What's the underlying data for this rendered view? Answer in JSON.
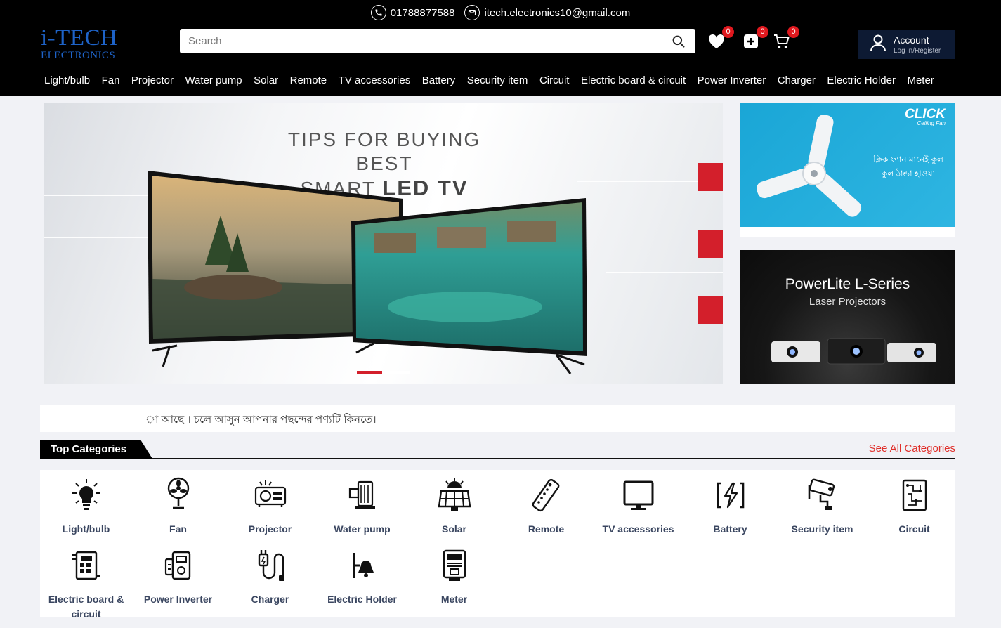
{
  "topbar": {
    "phone": "01788877588",
    "email": "itech.electronics10@gmail.com"
  },
  "logo": {
    "line1": "i-TECH",
    "line2": "ELECTRONICS"
  },
  "search": {
    "placeholder": "Search"
  },
  "header_icons": [
    {
      "icon": "heart-icon",
      "count": "0"
    },
    {
      "icon": "compare-icon",
      "count": "0"
    },
    {
      "icon": "cart-icon",
      "count": "0"
    }
  ],
  "account": {
    "label": "Account",
    "sub": "Log in/Register"
  },
  "nav": [
    "Light/bulb",
    "Fan",
    "Projector",
    "Water pump",
    "Solar",
    "Remote",
    "TV accessories",
    "Battery",
    "Security item",
    "Circuit",
    "Electric board & circuit",
    "Power Inverter",
    "Charger",
    "Electric Holder",
    "Meter"
  ],
  "hero": {
    "title_line1": "TIPS FOR BUYING BEST",
    "title_line2a": "SMART ",
    "title_line2b": "LED TV",
    "slides": 2,
    "active_slide": 1
  },
  "side_banner_1": {
    "brand": "CLICK",
    "brand_sub": "Ceiling Fan",
    "text": "ক্লিক ফ্যান মানেই কুল কুল ঠান্ডা হাওয়া"
  },
  "side_banner_2": {
    "title": "PowerLite L-Series",
    "subtitle": "Laser Projectors"
  },
  "marquee": {
    "text": "া আছে । চলে আসুন আপনার পছন্দের পণ্যটি কিনতে।"
  },
  "categories": {
    "title": "Top Categories",
    "see_all": "See All Categories",
    "items": [
      {
        "label": "Light/bulb",
        "icon": "bulb-icon"
      },
      {
        "label": "Fan",
        "icon": "fan-icon"
      },
      {
        "label": "Projector",
        "icon": "projector-icon"
      },
      {
        "label": "Water pump",
        "icon": "water-pump-icon"
      },
      {
        "label": "Solar",
        "icon": "solar-icon"
      },
      {
        "label": "Remote",
        "icon": "remote-icon"
      },
      {
        "label": "TV accessories",
        "icon": "tv-icon"
      },
      {
        "label": "Battery",
        "icon": "battery-icon"
      },
      {
        "label": "Security item",
        "icon": "security-camera-icon"
      },
      {
        "label": "Circuit",
        "icon": "circuit-icon"
      },
      {
        "label": "Electric board & circuit",
        "icon": "electric-board-icon"
      },
      {
        "label": "Power Inverter",
        "icon": "power-inverter-icon"
      },
      {
        "label": "Charger",
        "icon": "charger-icon"
      },
      {
        "label": "Electric Holder",
        "icon": "electric-holder-icon"
      },
      {
        "label": "Meter",
        "icon": "meter-icon"
      }
    ]
  },
  "colors": {
    "header_bg": "#000000",
    "accent_red": "#e0181e",
    "logo_blue": "#1e63c8",
    "account_bg": "#0d1a33",
    "category_text": "#3a4660"
  }
}
